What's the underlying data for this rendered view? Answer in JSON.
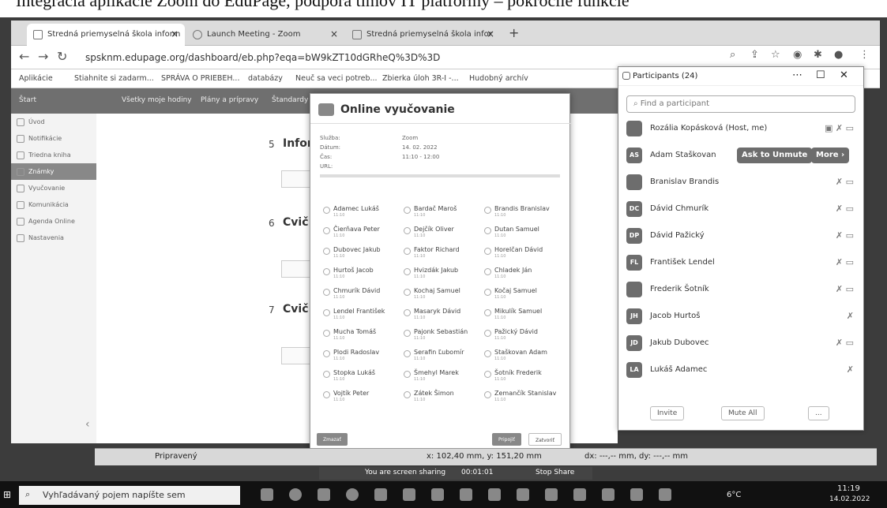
{
  "caption": "Integrácia aplikácie Zoom do EduPage, podpora tímov IT platformy – pokročilé funkcie",
  "browser": {
    "tabs": [
      {
        "label": "Stredná priemyselná škola inform"
      },
      {
        "label": "Launch Meeting - Zoom"
      },
      {
        "label": "Stredná priemyselná škola infor"
      }
    ],
    "url": "spsknm.edupage.org/dashboard/eb.php?eqa=bW9kZT10dGRheQ%3D%3D",
    "bookmarks": [
      "Aplikácie",
      "Stiahnite si zadarm...",
      "SPRÁVA O PRIEBEH...",
      "databázy",
      "Neuč sa veci potreb...",
      "Zbierka úloh 3R-I -...",
      "Hudobný archív"
    ]
  },
  "edupage": {
    "appbar": [
      "Štart",
      "Všetky moje hodiny",
      "Plány a prípravy",
      "Štandardy"
    ],
    "sidebar": [
      "Úvod",
      "Notifikácie",
      "Triedna kniha",
      "Známky",
      "Vyučovanie",
      "Komunikácia",
      "Agenda Online",
      "Nastavenia"
    ],
    "sections": [
      {
        "num": "5",
        "title": "Inform"
      },
      {
        "num": "6",
        "title": "Cvič"
      },
      {
        "num": "7",
        "title": "Cvič"
      }
    ]
  },
  "modal": {
    "title": "Online vyučovanie",
    "fields": [
      {
        "k": "Služba:",
        "v": "Zoom"
      },
      {
        "k": "Dátum:",
        "v": "14. 02. 2022"
      },
      {
        "k": "Čas:",
        "v": "11:10 - 12:00"
      },
      {
        "k": "URL:",
        "v": ""
      }
    ],
    "students": [
      {
        "name": "Adamec Lukáš",
        "time": "11:10"
      },
      {
        "name": "Bardač Maroš",
        "time": "11:10"
      },
      {
        "name": "Brandis Branislav",
        "time": "11:10"
      },
      {
        "name": "Čierňava Peter",
        "time": "11:10"
      },
      {
        "name": "Dejčík Oliver",
        "time": "11:10"
      },
      {
        "name": "Dutan Samuel",
        "time": "11:10"
      },
      {
        "name": "Dubovec Jakub",
        "time": "11:10"
      },
      {
        "name": "Faktor Richard",
        "time": "11:10"
      },
      {
        "name": "Horelčan Dávid",
        "time": "11:10"
      },
      {
        "name": "Hurtoš Jacob",
        "time": "11:10"
      },
      {
        "name": "Hvizdák Jakub",
        "time": "11:10"
      },
      {
        "name": "Chladek Ján",
        "time": "11:10"
      },
      {
        "name": "Chmurík Dávid",
        "time": "11:10"
      },
      {
        "name": "Kochaj Samuel",
        "time": "11:10"
      },
      {
        "name": "Kočaj Samuel",
        "time": "11:10"
      },
      {
        "name": "Lendel František",
        "time": "11:10"
      },
      {
        "name": "Masaryk Dávid",
        "time": "11:10"
      },
      {
        "name": "Mikulík Samuel",
        "time": "11:10"
      },
      {
        "name": "Mucha Tomáš",
        "time": "11:10"
      },
      {
        "name": "Pajonk Sebastián",
        "time": "11:10"
      },
      {
        "name": "Pažický Dávid",
        "time": "11:10"
      },
      {
        "name": "Plodi Radoslav",
        "time": "11:10"
      },
      {
        "name": "Serafin Ľubomír",
        "time": "11:10"
      },
      {
        "name": "Staškovan Adam",
        "time": "11:10"
      },
      {
        "name": "Stopka Lukáš",
        "time": "11:10"
      },
      {
        "name": "Šmehyl Marek",
        "time": "11:10"
      },
      {
        "name": "Šotník Frederik",
        "time": "11:10"
      },
      {
        "name": "Vojtík Peter",
        "time": "11:10"
      },
      {
        "name": "Zátek Šimon",
        "time": "11:10"
      },
      {
        "name": "Zemančík Stanislav",
        "time": "11:10"
      }
    ],
    "btn_left": "Zmazať",
    "btn_ok": "Pripojiť",
    "btn_close": "Zatvoriť"
  },
  "zoom": {
    "title": "Participants (24)",
    "search_placeholder": "Find a participant",
    "participants": [
      {
        "name": "Rozália Kopásková (Host, me)",
        "initials": "",
        "icons": "▣ ✗ ▭"
      },
      {
        "name": "Adam Staškovan",
        "initials": "AS",
        "icons": ""
      },
      {
        "name": "Branislav Brandis",
        "initials": "",
        "icons": "✗ ▭"
      },
      {
        "name": "Dávid Chmurík",
        "initials": "DC",
        "icons": "✗ ▭"
      },
      {
        "name": "Dávid Pažický",
        "initials": "DP",
        "icons": "✗ ▭"
      },
      {
        "name": "František Lendel",
        "initials": "FL",
        "icons": "✗ ▭"
      },
      {
        "name": "Frederik Šotník",
        "initials": "",
        "icons": "✗ ▭"
      },
      {
        "name": "Jacob Hurtoš",
        "initials": "JH",
        "icons": "✗"
      },
      {
        "name": "Jakub Dubovec",
        "initials": "JD",
        "icons": "✗ ▭"
      },
      {
        "name": "Lukáš Adamec",
        "initials": "LA",
        "icons": "✗"
      }
    ],
    "ask_unmute": "Ask to Unmute",
    "more": "More ›",
    "invite": "Invite",
    "mute_all": "Mute All",
    "more_dots": "..."
  },
  "status": {
    "ready": "Pripravený",
    "coords": "x: 102,40 mm, y: 151,20 mm",
    "delta": "dx: ---,-- mm, dy: ---,-- mm"
  },
  "sharing": {
    "text": "You are screen sharing",
    "time": "00:01:01",
    "stop": "Stop Share"
  },
  "taskbar": {
    "search": "Vyhľadávaný pojem napíšte sem",
    "weather": "6°C",
    "time": "11:19",
    "date": "14.02.2022"
  }
}
